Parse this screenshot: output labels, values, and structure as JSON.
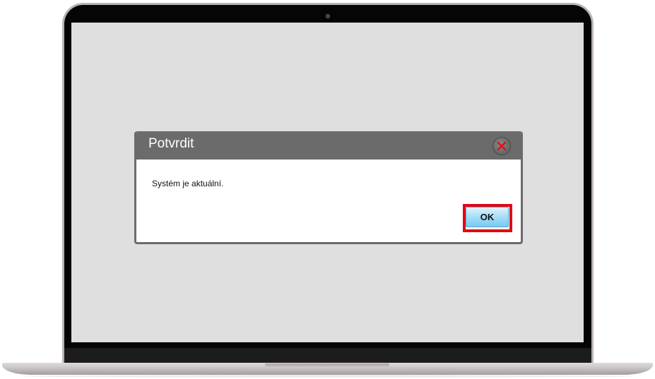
{
  "dialog": {
    "title": "Potvrdit",
    "message": "Systém je aktuální.",
    "ok_label": "OK",
    "close_icon": "close-icon"
  },
  "colors": {
    "screen_bg": "#dfdfdf",
    "dialog_header": "#6b6b6b",
    "close_x": "#d9141c",
    "ok_button": "#9fdbf6",
    "highlight": "#e30613"
  }
}
